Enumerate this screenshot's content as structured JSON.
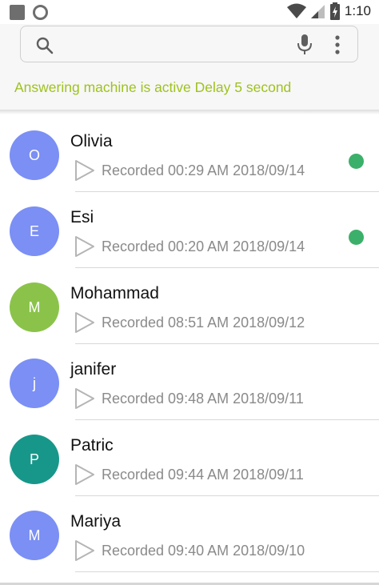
{
  "status_bar": {
    "time": "1:10",
    "left_icons": [
      "square-icon",
      "circle-icon"
    ],
    "right_icons": [
      "wifi-icon",
      "signal-icon",
      "battery-charging-icon"
    ]
  },
  "search": {
    "placeholder": "",
    "icons": [
      "search-icon",
      "mic-icon",
      "more-vert-icon"
    ]
  },
  "banner": {
    "text": "Answering machine is active Delay 5 second",
    "color": "#9ec21f"
  },
  "contacts": [
    {
      "initial": "O",
      "name": "Olivia",
      "recorded": "Recorded 00:29 AM 2018/09/14",
      "avatar_color": "#7b8ff4",
      "new": true
    },
    {
      "initial": "E",
      "name": "Esi",
      "recorded": "Recorded 00:20 AM 2018/09/14",
      "avatar_color": "#7b8ff4",
      "new": true
    },
    {
      "initial": "M",
      "name": "Mohammad",
      "recorded": "Recorded 08:51 AM 2018/09/12",
      "avatar_color": "#8bc34a",
      "new": false
    },
    {
      "initial": "j",
      "name": "janifer",
      "recorded": "Recorded 09:48 AM 2018/09/11",
      "avatar_color": "#7b8ff4",
      "new": false
    },
    {
      "initial": "P",
      "name": "Patric",
      "recorded": "Recorded 09:44 AM 2018/09/11",
      "avatar_color": "#17978a",
      "new": false
    },
    {
      "initial": "M",
      "name": "Mariya",
      "recorded": "Recorded 09:40 AM 2018/09/10",
      "avatar_color": "#7b8ff4",
      "new": false
    }
  ],
  "colors": {
    "new_indicator": "#3bb06a",
    "secondary_text": "#8a8a8a"
  }
}
